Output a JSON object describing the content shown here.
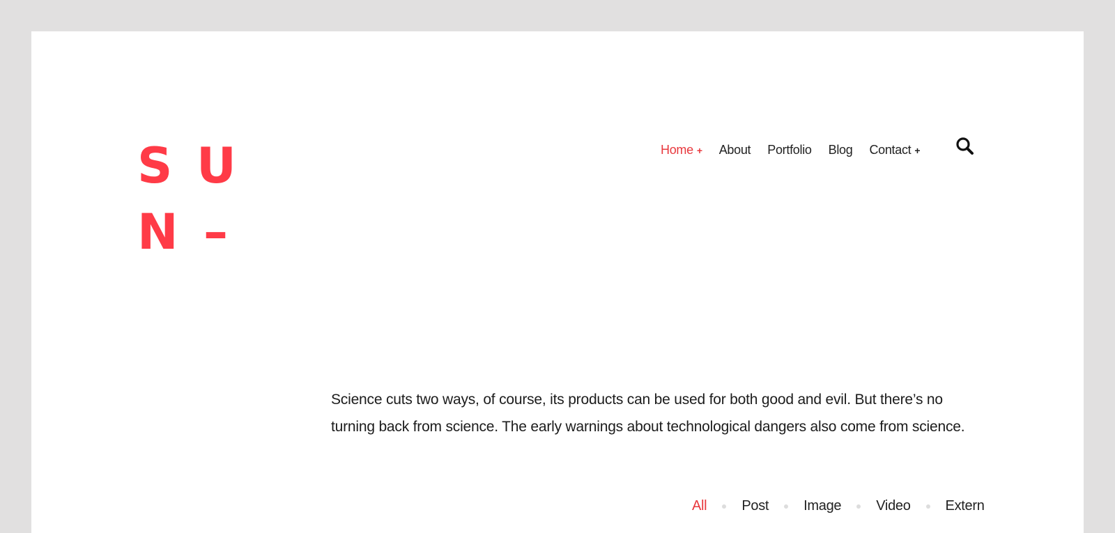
{
  "logo": {
    "letters": [
      "S",
      "U",
      "N",
      "–"
    ]
  },
  "nav": {
    "items": [
      {
        "label": "Home",
        "suffix": "+"
      },
      {
        "label": "About"
      },
      {
        "label": "Portfolio"
      },
      {
        "label": "Blog"
      },
      {
        "label": "Contact",
        "suffix": "+"
      }
    ],
    "active": "Home",
    "search_icon": "search-icon"
  },
  "intro": {
    "text": "Science cuts two ways, of course, its products can be used for both good and evil. But there’s no turning back from science. The early warnings about technological dangers also come from science."
  },
  "filters": {
    "items": [
      "All",
      "Post",
      "Image",
      "Video",
      "Extern"
    ],
    "active": "All"
  },
  "colors": {
    "accent": "#ff3b47",
    "text": "#222222",
    "background": "#e1e0e0",
    "card": "#ffffff"
  }
}
